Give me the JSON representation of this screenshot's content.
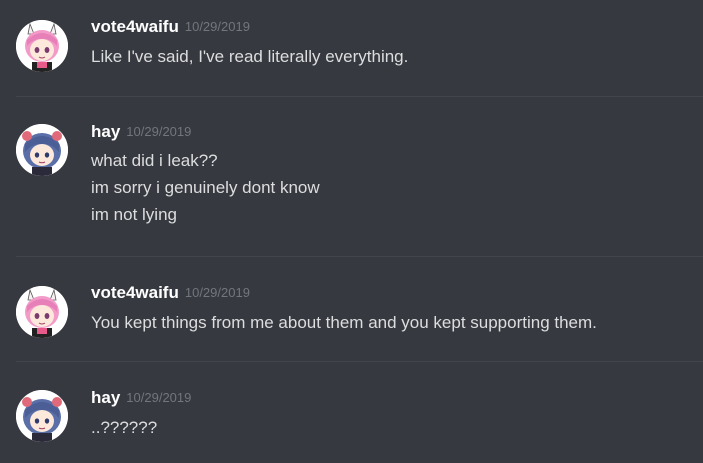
{
  "messages": [
    {
      "username": "vote4waifu",
      "timestamp": "10/29/2019",
      "lines": [
        "Like I've said, I've read literally everything."
      ],
      "avatar_icon": "anime-girl-pink-hair-avatar"
    },
    {
      "username": "hay",
      "timestamp": "10/29/2019",
      "lines": [
        "what did i leak??",
        "im sorry i genuinely dont know",
        "im not lying"
      ],
      "avatar_icon": "anime-girl-blue-hair-avatar"
    },
    {
      "username": "vote4waifu",
      "timestamp": "10/29/2019",
      "lines": [
        "You kept things from me about them and you kept supporting them."
      ],
      "avatar_icon": "anime-girl-pink-hair-avatar"
    },
    {
      "username": "hay",
      "timestamp": "10/29/2019",
      "lines": [
        "..??????"
      ],
      "avatar_icon": "anime-girl-blue-hair-avatar"
    }
  ],
  "colors": {
    "background": "#36393f",
    "username": "#ffffff",
    "message_text": "#dcddde",
    "timestamp": "#72767d",
    "divider": "#42454a"
  }
}
